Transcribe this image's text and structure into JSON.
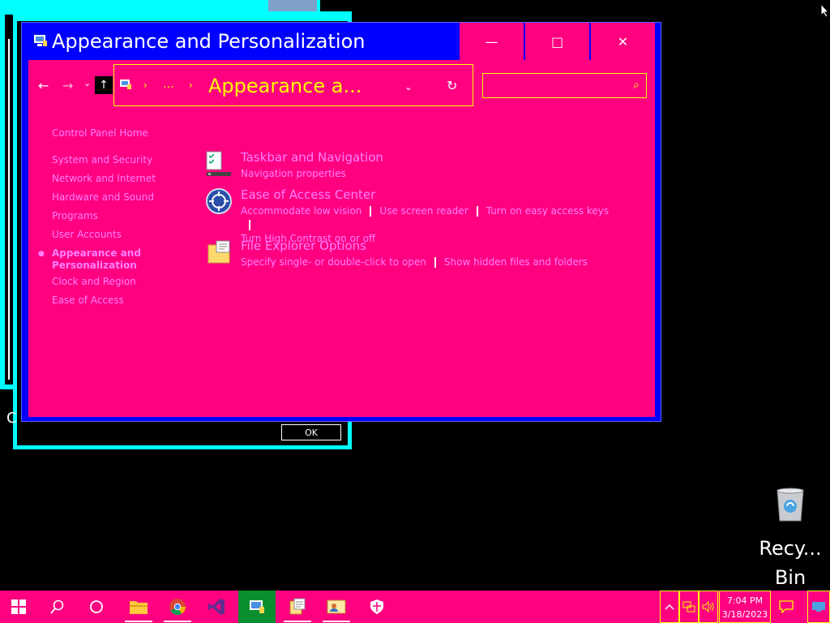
{
  "window": {
    "title": "Appearance and Personalization",
    "min_glyph": "—",
    "max_glyph": "□",
    "close_glyph": "✕"
  },
  "nav": {
    "back": "←",
    "forward": "→",
    "recent": "⌄",
    "up": "↑",
    "chevron": "›",
    "segment": "…",
    "address": "Appearance a...",
    "dropdown": "⌄",
    "refresh": "↻",
    "search_placeholder": "",
    "search_glyph": "⌕"
  },
  "left_pane": {
    "home": "Control Panel Home",
    "items": [
      "System and Security",
      "Network and Internet",
      "Hardware and Sound",
      "Programs",
      "User Accounts",
      "Appearance and",
      "Personalization",
      "Clock and Region",
      "Ease of Access"
    ],
    "bullet": "●"
  },
  "categories": [
    {
      "title": "Taskbar and Navigation",
      "icon": "taskbar-icon",
      "links": [
        "Navigation properties"
      ]
    },
    {
      "title": "Ease of Access Center",
      "icon": "ease-of-access-icon",
      "links": [
        "Accommodate low vision",
        "Use screen reader",
        "Turn on easy access keys",
        "Turn High Contrast on or off"
      ]
    },
    {
      "title": "File Explorer Options",
      "icon": "folder-options-icon",
      "links": [
        "Specify single- or double-click to open",
        "Show hidden files and folders"
      ]
    }
  ],
  "background": {
    "ok_label": "OK",
    "side_text": "C"
  },
  "desktop": {
    "recycle_line1": "Recy...",
    "recycle_line2": "Bin"
  },
  "taskbar": {
    "time": "7:04 PM",
    "date": "3/18/2023"
  },
  "colors": {
    "window_bg": "#ff0080",
    "frame": "#0000ff",
    "link": "#ff80ff",
    "address": "#ffff00",
    "bg_window_border": "#00ffff"
  }
}
